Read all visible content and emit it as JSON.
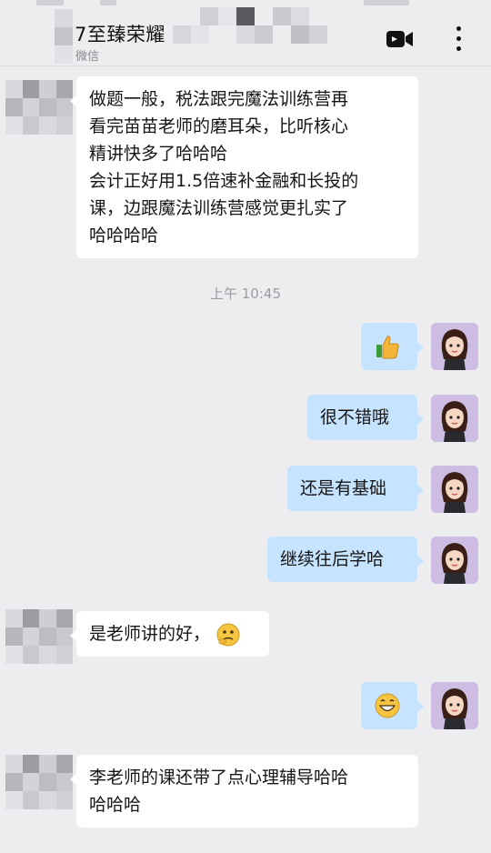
{
  "header": {
    "title": "7至臻荣耀",
    "subtitle": "微信",
    "video_icon": "video-call-icon",
    "more_icon": "more-vertical-icon"
  },
  "messages": [
    {
      "side": "in",
      "text_lines": [
        "做题一般，税法跟完魔法训练营再",
        "看完苗苗老师的磨耳朵，比听核心",
        "精讲快多了哈哈哈",
        "会计正好用1.5倍速补金融和长投的",
        "课，边跟魔法训练营感觉更扎实了",
        "哈哈哈哈"
      ]
    },
    {
      "side": "out",
      "emoji": "thumbs-up-icon"
    },
    {
      "side": "out",
      "text": "很不错哦"
    },
    {
      "side": "out",
      "text": "还是有基础"
    },
    {
      "side": "out",
      "text": "继续往后学哈"
    },
    {
      "side": "in",
      "text": "是老师讲的好，",
      "emoji": "thinking-face-icon"
    },
    {
      "side": "out",
      "emoji": "grinning-face-icon"
    },
    {
      "side": "in",
      "text_lines": [
        "李老师的课还带了点心理辅导哈哈",
        "哈哈哈"
      ]
    }
  ],
  "timestamp": "上午 10:45",
  "colors": {
    "background": "#ededf0",
    "incoming_bubble": "#ffffff",
    "outgoing_bubble": "#c6e4ff",
    "avatar_bg": "#c8b7df"
  }
}
